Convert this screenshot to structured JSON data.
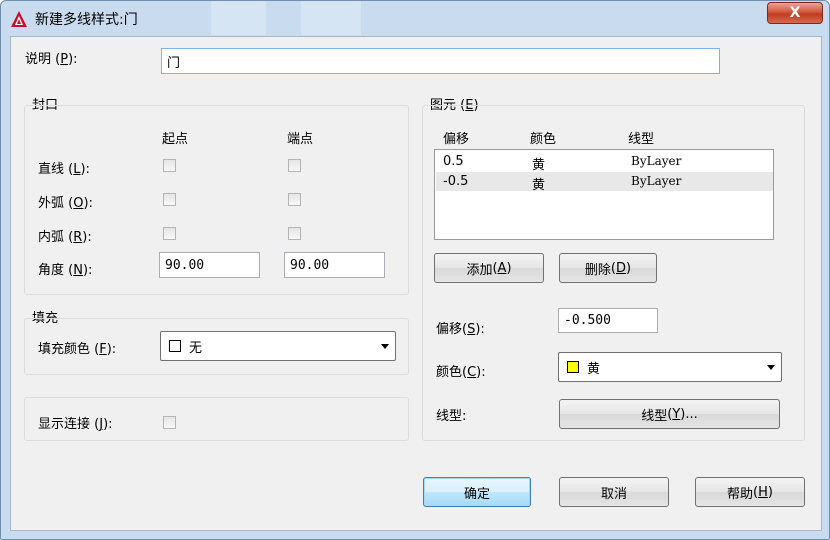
{
  "window": {
    "title": "新建多线样式:门",
    "close_label": "X"
  },
  "description": {
    "label": "说明",
    "key": "P",
    "value": "门"
  },
  "caps": {
    "group_label": "封口",
    "col_start": "起点",
    "col_end": "端点",
    "rows": [
      {
        "label": "直线",
        "key": "L",
        "start": false,
        "end": false
      },
      {
        "label": "外弧",
        "key": "O",
        "start": false,
        "end": false
      },
      {
        "label": "内弧",
        "key": "R",
        "start": false,
        "end": false
      }
    ],
    "angle": {
      "label": "角度",
      "key": "N",
      "start": "90.00",
      "end": "90.00"
    }
  },
  "fill": {
    "group_label": "填充",
    "label": "填充颜色",
    "key": "F",
    "value": "无",
    "swatch_color": "#ffffff"
  },
  "joints": {
    "label": "显示连接",
    "key": "J",
    "checked": false
  },
  "elements": {
    "group_label": "图元",
    "key": "E",
    "columns": [
      "偏移",
      "颜色",
      "线型"
    ],
    "rows": [
      {
        "offset": "0.5",
        "color": "黄",
        "linetype": "ByLayer"
      },
      {
        "offset": "-0.5",
        "color": "黄",
        "linetype": "ByLayer"
      }
    ],
    "add_label": "添加",
    "add_key": "A",
    "delete_label": "删除",
    "delete_key": "D",
    "offset_label": "偏移",
    "offset_key": "S",
    "offset_value": "-0.500",
    "color_label": "颜色",
    "color_key": "C",
    "color_value": "黄",
    "color_swatch": "#ffff00",
    "linetype_label": "线型:",
    "linetype_button": "线型",
    "linetype_key": "Y",
    "linetype_suffix": "..."
  },
  "footer": {
    "ok": "确定",
    "cancel": "取消",
    "help": "帮助",
    "help_key": "H"
  }
}
